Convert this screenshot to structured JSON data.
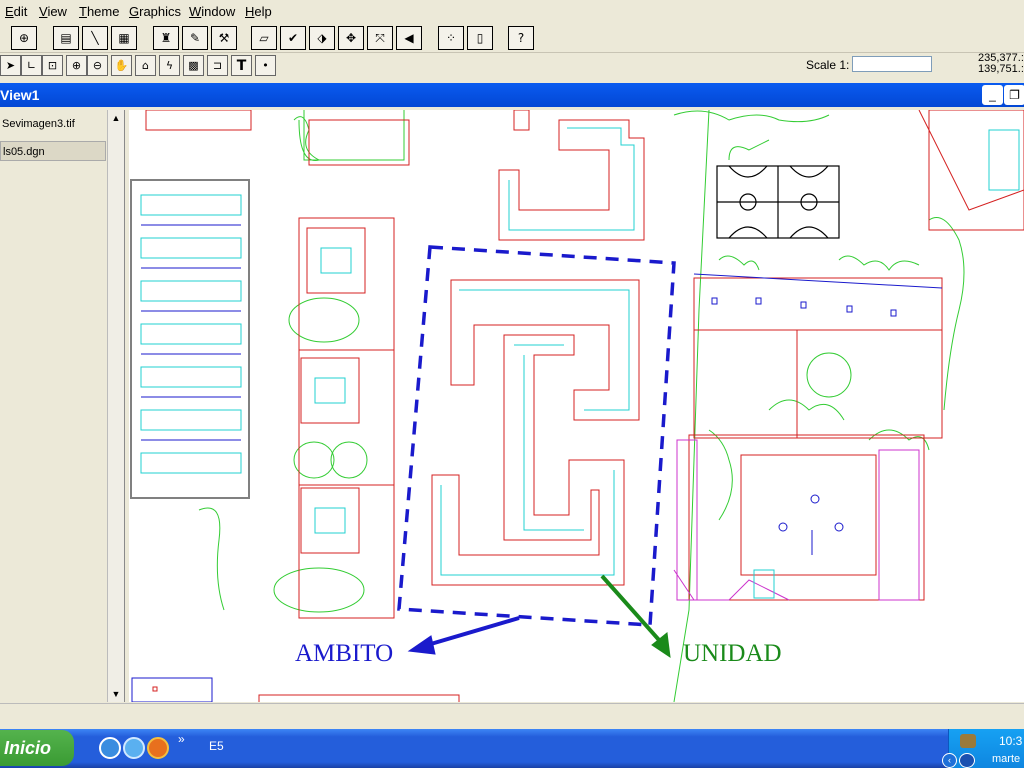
{
  "menubar": {
    "items": [
      "Edit",
      "View",
      "Theme",
      "Graphics",
      "Window",
      "Help"
    ]
  },
  "toolbar": {
    "buttons": [
      "add-theme-icon",
      "theme-properties-icon",
      "edit-legend-icon",
      "open-table-icon",
      "find-icon",
      "locate-icon",
      "hotlink-icon",
      "select-by-theme-icon",
      "query-builder-icon",
      "zoom-full-icon",
      "zoom-to-themes-icon",
      "zoom-selected-icon",
      "zoom-previous-icon",
      "select-all-icon",
      "layout-icon",
      "help-icon"
    ],
    "help_glyph": "?"
  },
  "toolbar2": {
    "tools": [
      "pointer-tool",
      "vertex-tool",
      "select-tool",
      "zoom-in-tool",
      "zoom-out-tool",
      "pan-tool",
      "measure-tool",
      "hotlink-tool",
      "area-tool",
      "label-tool",
      "text-tool",
      "point-tool"
    ],
    "text_glyph": "T",
    "scale_label": "Scale 1:",
    "scale_value": "",
    "coord_x": "235,377.:",
    "coord_y": "139,751.:"
  },
  "window": {
    "title": "View1"
  },
  "toc": {
    "items": [
      "Sevimagen3.tif",
      "ls05.dgn"
    ]
  },
  "annotations": {
    "ambito": "AMBITO",
    "unidad": "UNIDAD",
    "ambito_color": "#1a1acc",
    "unidad_color": "#1a8a1a"
  },
  "taskbar": {
    "start_label": "Inicio",
    "ql_more": "»",
    "task_label": "E5",
    "clock": "10:3",
    "day": "marte"
  },
  "colors": {
    "titlebar": "#0347d4",
    "building_outline": "#d42020",
    "unit_outline": "#20d0d0",
    "vegetation": "#33cc33",
    "boundary": "#1a1acc"
  }
}
